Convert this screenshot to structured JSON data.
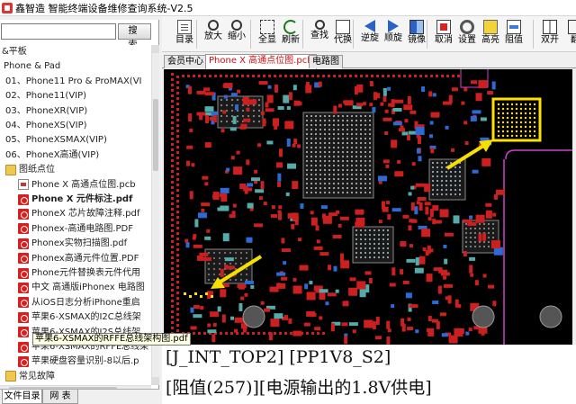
{
  "window": {
    "title": "鑫智造 智能终端设备维修查询系统-V2.5"
  },
  "search": {
    "button_label": "搜 索",
    "placeholder": ""
  },
  "tree": {
    "items": [
      {
        "label": "&平板",
        "type": "text"
      },
      {
        "label": "Phone & Pad",
        "type": "text"
      },
      {
        "label": "01、Phone11 Pro & ProMAX(VI",
        "type": "text"
      },
      {
        "label": "02、Phone11(VIP)",
        "type": "text"
      },
      {
        "label": "03、PhoneXR(VIP)",
        "type": "text"
      },
      {
        "label": "04、PhoneXS(VIP)",
        "type": "text"
      },
      {
        "label": "05、PhoneXSMAX(VIP)",
        "type": "text"
      },
      {
        "label": "06、PhoneX高通(VIP)",
        "type": "text"
      },
      {
        "label": "图纸点位",
        "type": "folder"
      },
      {
        "label": "Phone X 高通点位图.pcb",
        "type": "pcb"
      },
      {
        "label": "Phone X 元件标注.pdf",
        "type": "pdf",
        "bold": true
      },
      {
        "label": "PhoneX 芯片故障注释.pdf",
        "type": "pdf"
      },
      {
        "label": "Phonex-高通电路图.PDF",
        "type": "pdf"
      },
      {
        "label": "Phonex实物扫描图.pdf",
        "type": "pdf"
      },
      {
        "label": "Phonex高通元件位置.PDF",
        "type": "pdf"
      },
      {
        "label": "Phone元件替换表元件代用",
        "type": "pdf"
      },
      {
        "label": "中文 高通版iPhonex 电路图",
        "type": "pdf"
      },
      {
        "label": "从iOS日志分析iPhone重启",
        "type": "pdf"
      },
      {
        "label": "苹果6-XSMAX的I2C总线架",
        "type": "pdf"
      },
      {
        "label": "苹果6-XSMAX的I2S总线架",
        "type": "pdf"
      },
      {
        "label": "苹果6-XSMAX的RFFE总线架",
        "type": "pdf"
      },
      {
        "label": "苹果硬盘容量识别-8以后.p",
        "type": "pdf"
      },
      {
        "label": "常见故障",
        "type": "folder"
      }
    ],
    "tooltip": "苹果6-XSMAX的RFFE总线架构图.pdf"
  },
  "left_tabs": [
    {
      "label": "文件目录"
    },
    {
      "label": "网 表"
    }
  ],
  "toolbar": [
    {
      "label": "目录",
      "icon": "catalog-icon"
    },
    {
      "label": "放大",
      "icon": "zoom-in-icon"
    },
    {
      "label": "缩小",
      "icon": "zoom-out-icon"
    },
    {
      "label": "全显",
      "icon": "fit-all-icon"
    },
    {
      "label": "刷新",
      "icon": "refresh-icon"
    },
    {
      "label": "查找",
      "icon": "find-icon"
    },
    {
      "label": "代换",
      "icon": "replace-icon"
    },
    {
      "label": "逆旋",
      "icon": "rotate-ccw-icon"
    },
    {
      "label": "顺旋",
      "icon": "rotate-cw-icon"
    },
    {
      "label": "镜像",
      "icon": "mirror-icon"
    },
    {
      "label": "取消",
      "icon": "cancel-icon"
    },
    {
      "label": "设置",
      "icon": "settings-icon"
    },
    {
      "label": "高亮",
      "icon": "highlight-icon"
    },
    {
      "label": "阻值",
      "icon": "resistance-icon"
    },
    {
      "label": "双开",
      "icon": "dual-open-icon"
    },
    {
      "label": "翻",
      "icon": "flip-icon"
    }
  ],
  "doc_tabs": [
    {
      "label": "会员中心",
      "active": false
    },
    {
      "label": "Phone X 高通点位图.pcb",
      "active": true
    },
    {
      "label": "电路图",
      "active": false
    }
  ],
  "info": {
    "line1": "[J_INT_TOP2] [PP1V8_S2]",
    "line2": "[阻值(257)][电源输出的1.8V供电]"
  },
  "colors": {
    "pad": "#cc1f1f",
    "highlight": "#ffe000",
    "arrow": "#f5e000",
    "board_bg": "#000000",
    "outline": "#d040d0"
  }
}
